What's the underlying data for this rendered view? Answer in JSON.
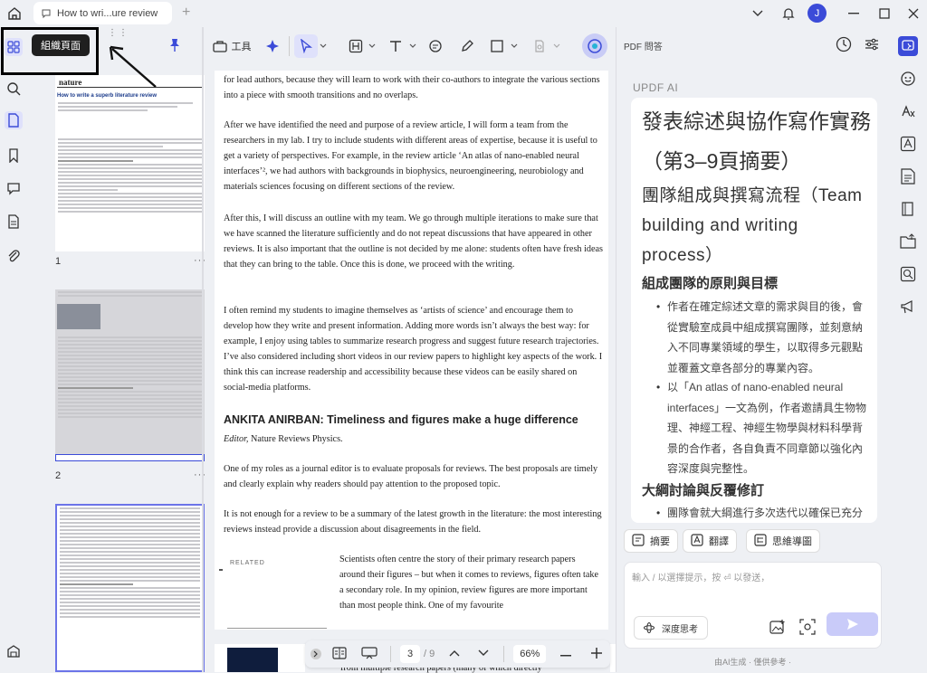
{
  "titlebar": {
    "tab_title": "How to wri...ure review",
    "avatar_letter": "J"
  },
  "tooltip": {
    "label": "組織頁面"
  },
  "thumbnails": {
    "pages": [
      {
        "num": "1"
      },
      {
        "num": "2"
      }
    ],
    "more": "···"
  },
  "toolbar": {
    "tools_label": "工具"
  },
  "document": {
    "paragraphs": [
      "for lead authors, because they will learn to work with their co-authors to integrate the various sections into a piece with smooth transitions and no overlaps.",
      "After we have identified the need and purpose of a review article, I will form a team from the researchers in my lab. I try to include students with different areas of expertise, because it is useful to get a variety of perspectives. For example, in the review article ‘An atlas of nano-enabled neural interfaces’², we had authors with backgrounds in biophysics, neuroengineering, neurobiology and materials sciences focusing on different sections of the review.",
      "After this, I will discuss an outline with my team. We go through multiple iterations to make sure that we have scanned the literature sufficiently and do not repeat discussions that have appeared in other reviews. It is also important that the outline is not decided by me alone: students often have fresh ideas that they can bring to the table. Once this is done, we proceed with the writing.",
      "I often remind my students to imagine themselves as ‘artists of science’ and encourage them to develop how they write and present information. Adding more words isn’t always the best way: for example, I enjoy using tables to summarize research progress and suggest future research trajectories. I’ve also considered including short videos in our review papers to highlight key aspects of the work. I think this can increase readership and accessibility because these videos can be easily shared on social-media platforms.",
      "One of my roles as a journal editor is to evaluate proposals for reviews. The best proposals are timely and clearly explain why readers should pay attention to the proposed topic.",
      "It is not enough for a review to be a summary of the latest growth in the literature: the most interesting reviews instead provide a discussion about disagreements in the field.",
      "Scientists often centre the story of their primary research papers around their figures – but when it comes to reviews, figures often take a secondary role. In my opinion, review figures are more important than most people think. One of my favourite",
      "from multiple research papers (many of which directly"
    ],
    "heading": "ANKITA ANIRBAN: Timeliness and figures make a huge difference",
    "editor_role": "Editor,",
    "editor_journal": "Nature Reviews Physics.",
    "related": "RELATED"
  },
  "pager": {
    "current": "3",
    "total": "/ 9",
    "zoom": "66%"
  },
  "right_panel": {
    "title": "PDF 問答",
    "ai_label": "UPDF AI",
    "h1": "發表綜述與協作寫作實務（第3–9頁摘要）",
    "h2": "團隊組成與撰寫流程（Team building and writing process）",
    "h3a": "組成團隊的原則與目標",
    "bullets": [
      "作者在確定綜述文章的需求與目的後，會從實驗室成員中組成撰寫團隊，並刻意納入不同專業領域的學生，以取得多元觀點並覆蓋文章各部分的專業內容。",
      "以「An atlas of nano-enabled neural interfaces」一文為例，作者邀請具生物物理、神經工程、神經生物學與材料科學背景的合作者，各自負責不同章節以強化內容深度與完整性。"
    ],
    "h3b": "大綱討論與反覆修訂",
    "partial": "團隊會就大綱進行多次迭代以確保已充分",
    "chips": {
      "summary": "摘要",
      "translate": "翻譯",
      "mindmap": "思維導圖"
    },
    "input_placeholder": "輸入 / 以選擇提示，按 ⏎ 以發送，",
    "deep_think": "深度思考",
    "footnote": "由AI生成 · 僅供參考 ·"
  }
}
